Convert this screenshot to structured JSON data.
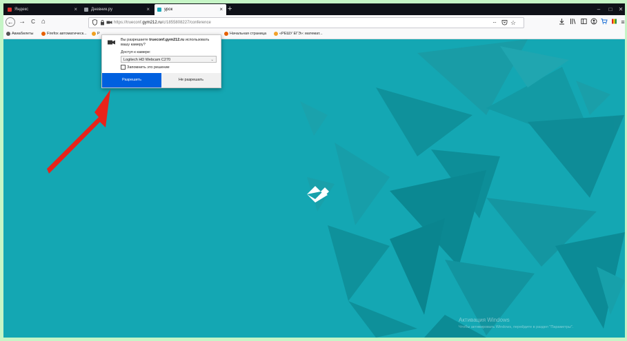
{
  "tabs": [
    {
      "label": "Яндекс",
      "active": false,
      "icon_color": "#e0302d"
    },
    {
      "label": "Дневник.ру",
      "active": false,
      "icon_color": "#9aa0a6"
    },
    {
      "label": "урок",
      "active": true,
      "icon_color": "#1aa8b8"
    }
  ],
  "tab_close": "×",
  "new_tab": "+",
  "window_controls": {
    "minimize": "–",
    "maximize": "□",
    "close": "✕"
  },
  "nav": {
    "back": "←",
    "forward": "→",
    "reload": "C",
    "home": "⌂"
  },
  "urlbar": {
    "url_prefix": "https://trueconf.",
    "url_domain": "gym212.ru",
    "url_suffix": "/c/1855808227/conference",
    "more": "···",
    "star": "☆"
  },
  "bookmarks": [
    {
      "label": "Авиабилеты",
      "icon_color": "#555"
    },
    {
      "label": "Firefox автоматическ...",
      "icon_color": "#e66000"
    },
    {
      "label": "Р",
      "icon_color": "#f0a020"
    },
    {
      "label": "Начальная страница",
      "icon_color": "#e66000"
    },
    {
      "label": "«РЕШУ ЕГЭ»: математ...",
      "icon_color": "#f2a12a"
    }
  ],
  "permission_popup": {
    "message_prefix": "Вы разрешаете ",
    "message_site": "trueconf.gym212.ru",
    "message_suffix": " использовать вашу камеру?",
    "camera_label": "Доступ к камере:",
    "camera_selected": "Logitech HD Webcam C270",
    "remember_label": "Запомнить это решение",
    "allow_button": "Разрешить",
    "deny_button": "Не разрешать"
  },
  "watermark": {
    "title": "Активация Windows",
    "subtitle": "Чтобы активировать Windows, перейдите в раздел \"Параметры\"."
  },
  "colors": {
    "background": "#14a7b3",
    "allow_button": "#0060df",
    "arrow": "#e8231a",
    "outer_border": "#c6f5c6"
  }
}
